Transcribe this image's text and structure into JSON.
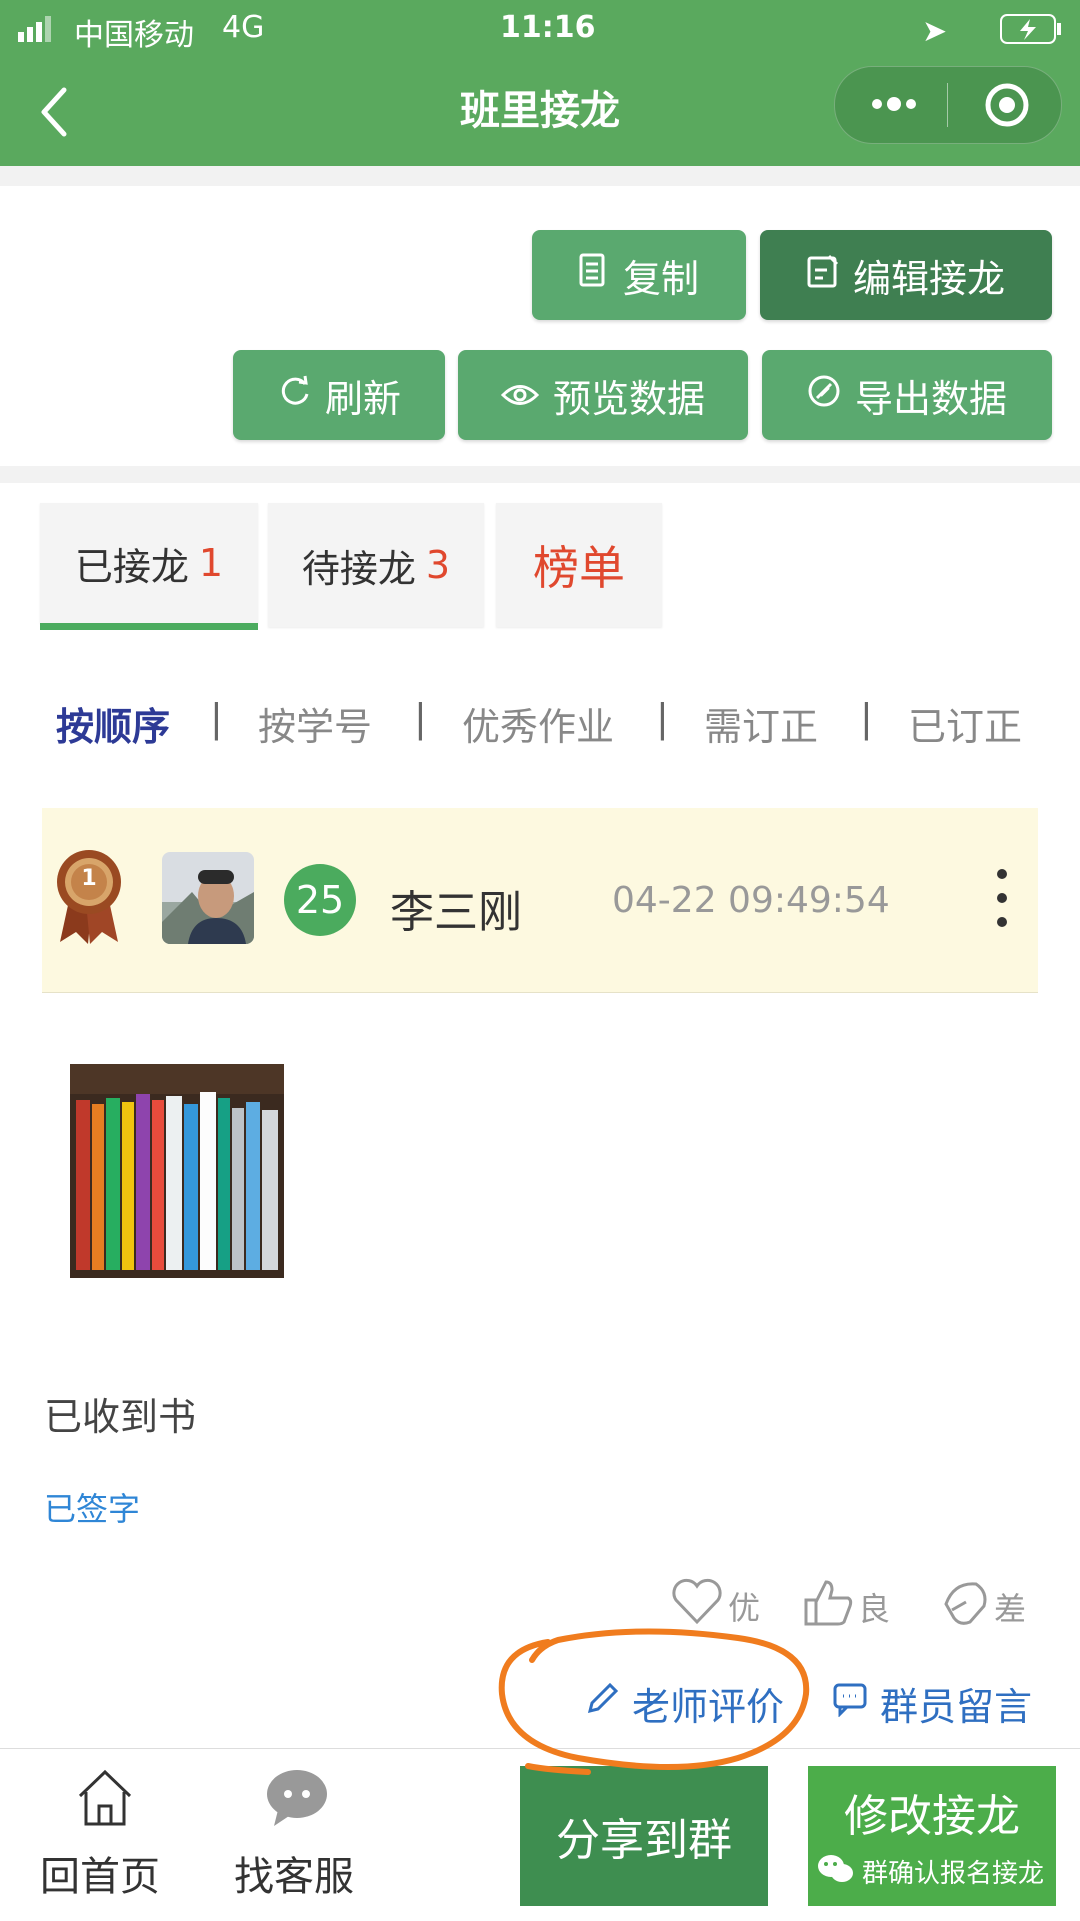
{
  "status_bar": {
    "carrier": "中国移动",
    "network": "4G",
    "time": "11:16"
  },
  "nav": {
    "title": "班里接龙"
  },
  "toolbar": {
    "copy": "复制",
    "edit": "编辑接龙",
    "refresh": "刷新",
    "preview": "预览数据",
    "export": "导出数据"
  },
  "tabs": [
    {
      "label": "已接龙",
      "count": "1"
    },
    {
      "label": "待接龙",
      "count": "3"
    },
    {
      "label": "榜单"
    }
  ],
  "filters": [
    "按顺序",
    "按学号",
    "优秀作业",
    "需订正",
    "已订正"
  ],
  "filter_separator": "|",
  "entry": {
    "medal_rank": "1",
    "number": "25",
    "name": "李三刚",
    "time": "04-22 09:49:54",
    "text": "已收到书",
    "status": "已签字"
  },
  "ratings": [
    "优",
    "良",
    "差"
  ],
  "actions": {
    "teacher_review": "老师评价",
    "member_comment": "群员留言"
  },
  "bottom_bar": {
    "home": "回首页",
    "service": "找客服",
    "share": "分享到群",
    "modify": "修改接龙",
    "watermark": "群确认报名接龙"
  },
  "colors": {
    "theme_green": "#5aa95e",
    "count_red": "#e0482e",
    "active_filter": "#2d3a96",
    "link_blue": "#2f6fc1",
    "annotation_orange": "#f07c1e"
  }
}
